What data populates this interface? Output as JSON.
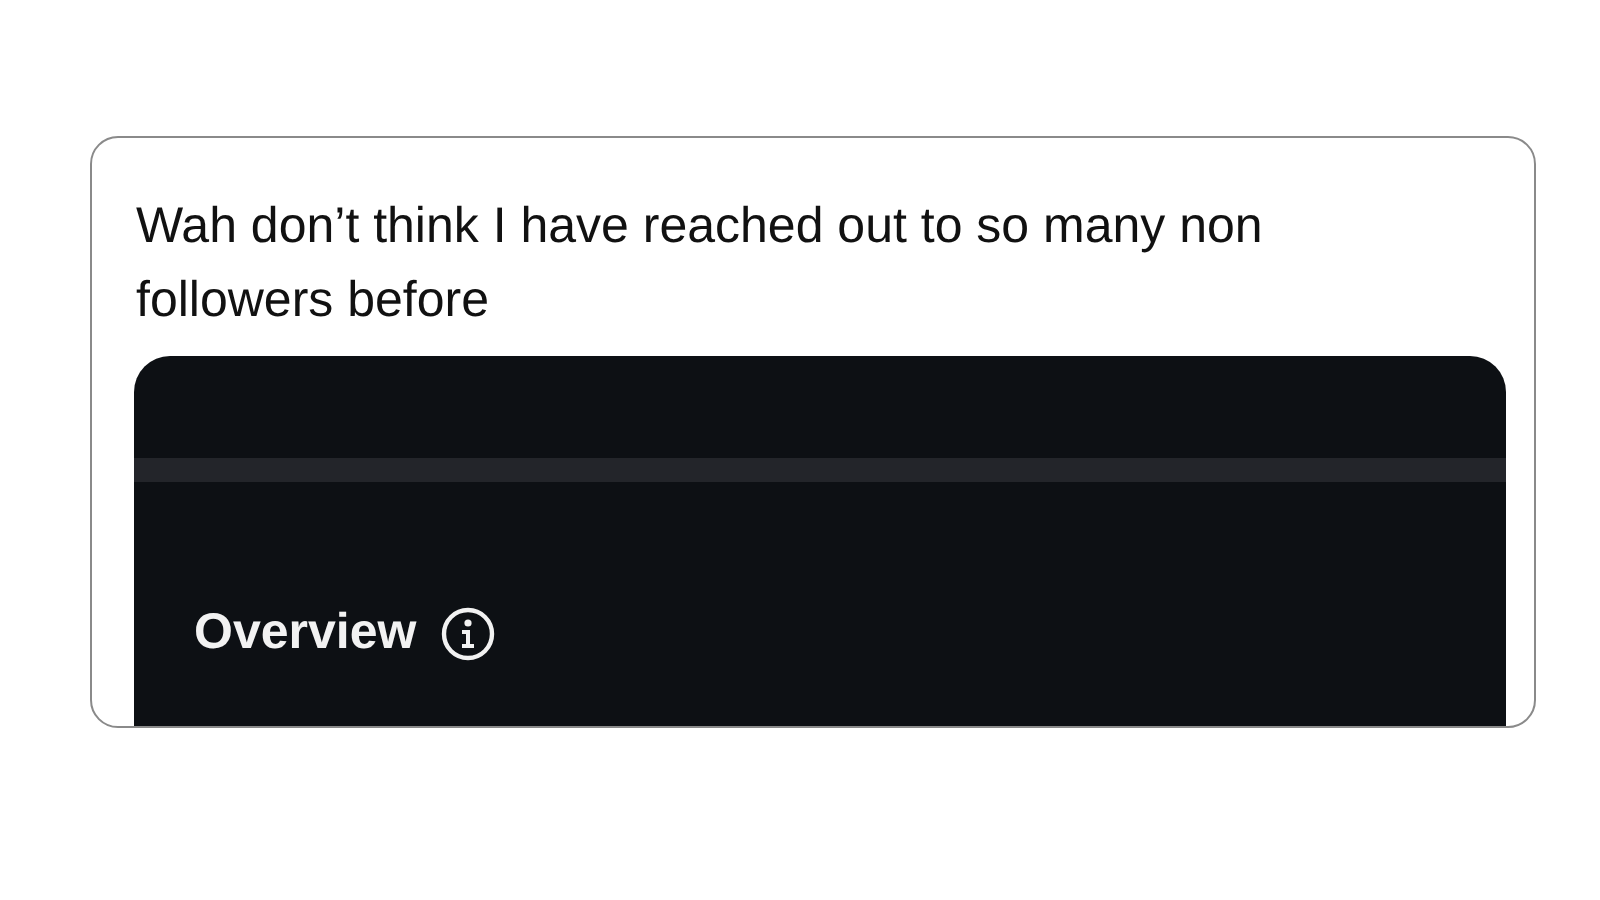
{
  "tweet": {
    "text": "Wah don’t think I have reached out to so many non followers before"
  },
  "attached_screenshot": {
    "heading": "Overview"
  }
}
